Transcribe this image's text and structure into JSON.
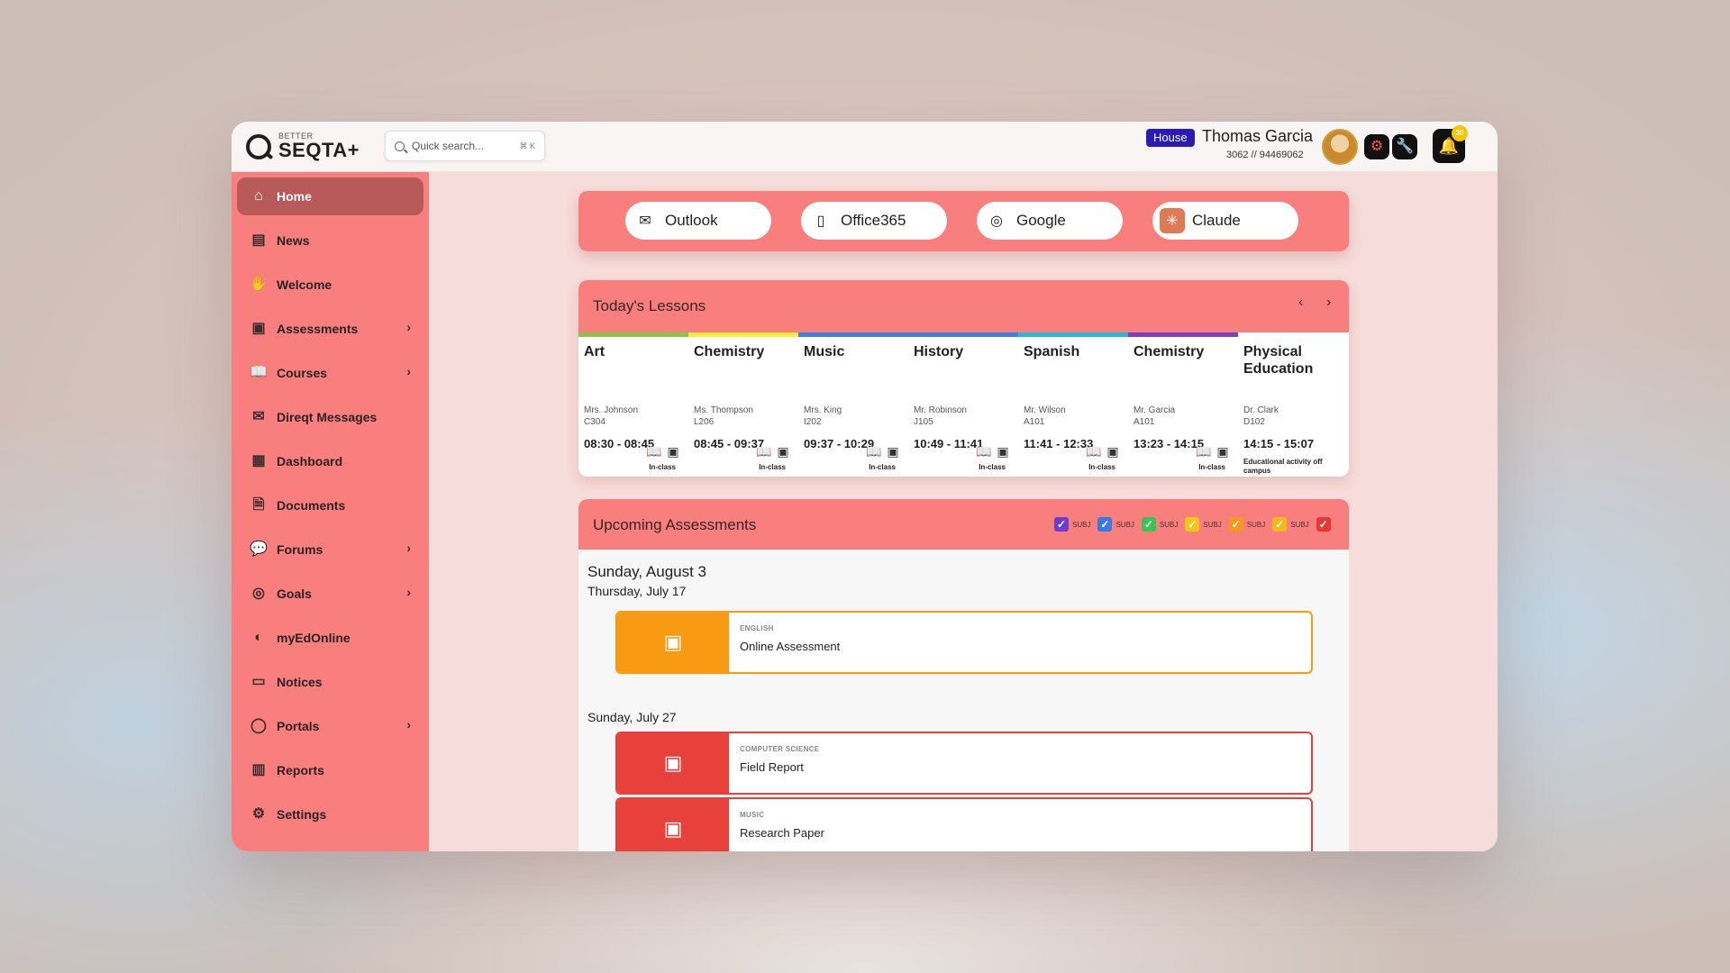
{
  "brand": {
    "small": "BETTER",
    "name": "SEQTA+"
  },
  "search": {
    "placeholder": "Quick search...",
    "shortcut": "⌘ K"
  },
  "user": {
    "badge": "House",
    "name": "Thomas Garcia",
    "id": "3062 // 94469062",
    "notifications": "30"
  },
  "sidebar": {
    "items": [
      {
        "label": "Home",
        "icon": "home-icon",
        "active": true
      },
      {
        "label": "News",
        "icon": "news-icon"
      },
      {
        "label": "Welcome",
        "icon": "welcome-icon"
      },
      {
        "label": "Assessments",
        "icon": "assessments-icon",
        "chevron": true
      },
      {
        "label": "Courses",
        "icon": "courses-icon",
        "chevron": true
      },
      {
        "label": "Direqt Messages",
        "icon": "messages-icon"
      },
      {
        "label": "Dashboard",
        "icon": "dashboard-icon"
      },
      {
        "label": "Documents",
        "icon": "documents-icon"
      },
      {
        "label": "Forums",
        "icon": "forums-icon",
        "chevron": true
      },
      {
        "label": "Goals",
        "icon": "goals-icon",
        "chevron": true
      },
      {
        "label": "myEdOnline",
        "icon": "myedonline-icon"
      },
      {
        "label": "Notices",
        "icon": "notices-icon"
      },
      {
        "label": "Portals",
        "icon": "portals-icon",
        "chevron": true
      },
      {
        "label": "Reports",
        "icon": "reports-icon"
      },
      {
        "label": "Settings",
        "icon": "settings-icon"
      }
    ]
  },
  "launcher": [
    {
      "label": "Outlook",
      "icon": "outlook-icon"
    },
    {
      "label": "Office365",
      "icon": "office365-icon"
    },
    {
      "label": "Google",
      "icon": "google-icon"
    },
    {
      "label": "Claude",
      "icon": "claude-icon"
    }
  ],
  "lessons": {
    "title": "Today's Lessons",
    "items": [
      {
        "subject": "Art",
        "teacher": "Mrs. Johnson",
        "room": "C304",
        "time": "08:30 - 08:45",
        "mode": "In-class",
        "color": "#8bc34a"
      },
      {
        "subject": "Chemistry",
        "teacher": "Ms. Thompson",
        "room": "L206",
        "time": "08:45 - 09:37",
        "mode": "In-class",
        "color": "#ffeb3b"
      },
      {
        "subject": "Music",
        "teacher": "Mrs. King",
        "room": "I202",
        "time": "09:37 - 10:29",
        "mode": "In-class",
        "color": "#3f7fe0"
      },
      {
        "subject": "History",
        "teacher": "Mr. Robinson",
        "room": "J105",
        "time": "10:49 - 11:41",
        "mode": "In-class",
        "color": "#3f7fe0"
      },
      {
        "subject": "Spanish",
        "teacher": "Mr. Wilson",
        "room": "A101",
        "time": "11:41 - 12:33",
        "mode": "In-class",
        "color": "#29b6d8"
      },
      {
        "subject": "Chemistry",
        "teacher": "Mr. Garcia",
        "room": "A101",
        "time": "13:23 - 14:15",
        "mode": "In-class",
        "color": "#7e3fbf"
      },
      {
        "subject": "Physical Education",
        "teacher": "Dr. Clark",
        "room": "D102",
        "time": "14:15 - 15:07",
        "mode": "Educational activity off campus",
        "color": "#ffffff"
      }
    ]
  },
  "assessments": {
    "title": "Upcoming Assessments",
    "filters": [
      {
        "label": "SUBJ",
        "color": "#6a3fd0"
      },
      {
        "label": "SUBJ",
        "color": "#3a7ae6"
      },
      {
        "label": "SUBJ",
        "color": "#3cc05a"
      },
      {
        "label": "SUBJ",
        "color": "#f5c518"
      },
      {
        "label": "SUBJ",
        "color": "#f39a1e"
      },
      {
        "label": "SUBJ",
        "color": "#f5b81c"
      },
      {
        "label": "",
        "color": "#e53935"
      }
    ],
    "date_main": "Sunday, August 3",
    "date_sub": "Thursday, July 17",
    "date_sub2": "Sunday, July 27",
    "cards": [
      {
        "subject": "ENGLISH",
        "title": "Online Assessment",
        "color": "#f89a12"
      },
      {
        "subject": "COMPUTER SCIENCE",
        "title": "Field Report",
        "color": "#e8403a"
      },
      {
        "subject": "MUSIC",
        "title": "Research Paper",
        "color": "#e8403a"
      }
    ]
  }
}
